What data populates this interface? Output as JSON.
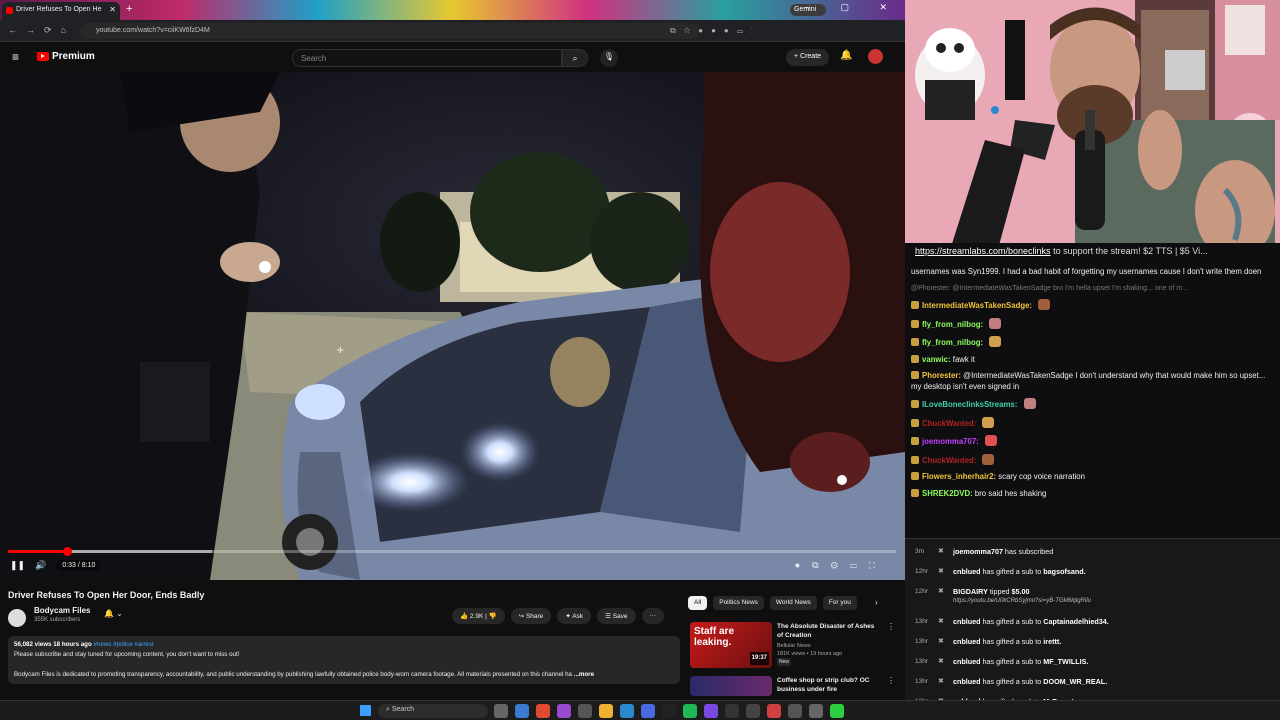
{
  "browser": {
    "tab_title": "Driver Refuses To Open He",
    "new_tab": "+",
    "gemini": "Gemini",
    "url": "youtube.com/watch?v=ciiKW6fzD4M",
    "window_controls": "– ▢ ✕"
  },
  "youtube_header": {
    "logo_text": "Premium",
    "search_placeholder": "Search",
    "create_label": "+ Create"
  },
  "player": {
    "current_time": "0:33 / 8:10",
    "progress_fraction": 0.067,
    "buffered_fraction": 0.23
  },
  "video_info": {
    "title": "Driver Refuses To Open Her Door, Ends Badly",
    "channel_name": "Bodycam Files",
    "subscribers": "355K subscribers",
    "likes": "2.9K",
    "share_label": "Share",
    "ask_label": "Ask",
    "save_label": "Save",
    "more_label": "···",
    "views_date": "56,082 views  18 hours ago",
    "tags": "#news #police #arrest",
    "desc_line1": "Please subscribe and stay tuned for upcoming content, you don't want to miss out!",
    "desc_line2": "Bodycam Files is dedicated to promoting transparency, accountability, and public understanding by publishing lawfully obtained police body-worn camera footage. All materials presented on this channel ha",
    "desc_more": "...more"
  },
  "chips": [
    "All",
    "Politics News",
    "World News",
    "For you"
  ],
  "recommendations": [
    {
      "thumb_text": "Staff are leaking.",
      "duration": "19:37",
      "title": "The Absolute Disaster of Ashes of Creation",
      "channel": "Bellular News",
      "meta": "181K views • 19 hours ago",
      "badge": "New"
    },
    {
      "thumb_text": "",
      "duration": "",
      "title": "Coffee shop or strip club? OC business under fire",
      "channel": "",
      "meta": "",
      "badge": ""
    }
  ],
  "chat": {
    "banner_link": "https://streamlabs.com/boneclinks",
    "banner_rest": " to support the stream! $2 TTS | $5 Vi...",
    "messages": [
      {
        "user": "",
        "color": "#efeff1",
        "text": "usernames was Syn1999. I had a bad habit of forgetting my usernames cause I don't write them doen"
      },
      {
        "user": "",
        "color": "#777",
        "text": "@Phorester: @IntermediateWasTakenSadge bro I'm hella upset I'm shaking... one of m..."
      },
      {
        "user": "IntermediateWasTakenSadge:",
        "color": "#f0c33a",
        "text": ""
      },
      {
        "user": "fly_from_nilbog:",
        "color": "#8ffd5d",
        "text": ""
      },
      {
        "user": "fly_from_nilbog:",
        "color": "#8ffd5d",
        "text": ""
      },
      {
        "user": "vanwic:",
        "color": "#8ffd5d",
        "text": "fawk it"
      },
      {
        "user": "Phorester:",
        "color": "#f0c33a",
        "text": "@IntermediateWasTakenSadge I don't understand why that would make him so upset... my desktop isn't even signed in"
      },
      {
        "user": "ILoveBoneclinksStreams:",
        "color": "#40d0b0",
        "text": ""
      },
      {
        "user": "ChuckWanted:",
        "color": "#b22222",
        "text": ""
      },
      {
        "user": "joemomma707:",
        "color": "#c040ff",
        "text": ""
      },
      {
        "user": "ChuckWanted:",
        "color": "#b22222",
        "text": ""
      },
      {
        "user": "Flowers_inherhair2:",
        "color": "#f0c33a",
        "text": "scary cop voice narration"
      },
      {
        "user": "SHREK2DVD:",
        "color": "#8ffd5d",
        "text": "bro said hes shaking"
      }
    ]
  },
  "events": [
    {
      "time": "3m",
      "user": "joemomma707",
      "text": " has subscribed",
      "sub": ""
    },
    {
      "time": "12hr",
      "user": "cnblued",
      "text": " has gifted a sub to ",
      "target": "bagsofsand.",
      "sub": ""
    },
    {
      "time": "12hr",
      "user": "BIGDAIRY",
      "text": " tipped ",
      "target": "$5.00",
      "sub": "https://youtu.be/U0kCRbSyjmo?si=yB-TGkl6lqlgRilu"
    },
    {
      "time": "13hr",
      "user": "cnblued",
      "text": " has gifted a sub to ",
      "target": "Captainadelhied34.",
      "sub": ""
    },
    {
      "time": "13hr",
      "user": "cnblued",
      "text": " has gifted a sub to ",
      "target": "irettt.",
      "sub": ""
    },
    {
      "time": "13hr",
      "user": "cnblued",
      "text": " has gifted a sub to ",
      "target": "MF_TWILLIS.",
      "sub": ""
    },
    {
      "time": "13hr",
      "user": "cnblued",
      "text": " has gifted a sub to ",
      "target": "DOOM_WR_REAL.",
      "sub": ""
    },
    {
      "time": "13hr",
      "user": "cnblued",
      "text": " has gifted a sub to ",
      "target": "MrEmeat.",
      "sub": ""
    }
  ],
  "taskbar": {
    "search_placeholder": "Search"
  }
}
